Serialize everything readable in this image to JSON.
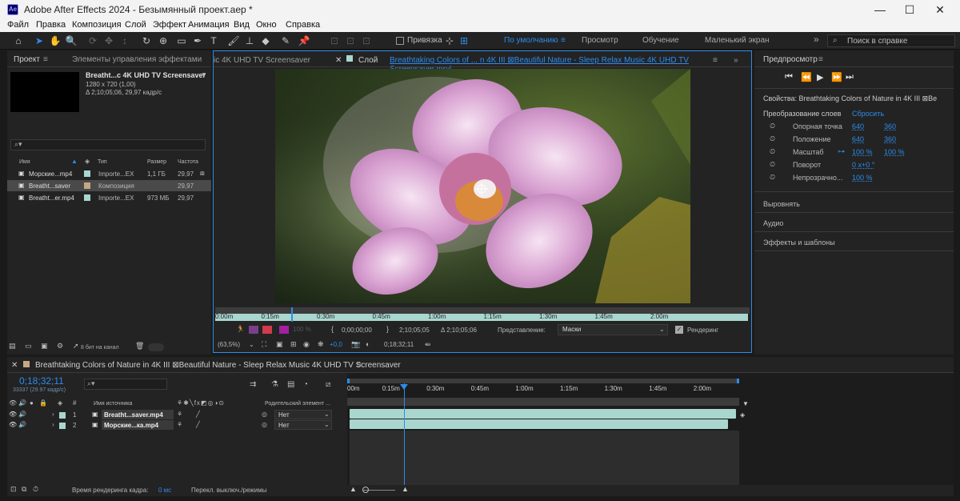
{
  "window": {
    "title": "Adobe After Effects 2024 - Безымянный проект.aep *",
    "app_badge": "Ae"
  },
  "menu": [
    "Файл",
    "Правка",
    "Композиция",
    "Слой",
    "Эффект",
    "Анимация",
    "Вид",
    "Окно",
    "Справка"
  ],
  "toolbar": {
    "snap_label": "Привязка",
    "workspaces": [
      "По умолчанию",
      "Просмотр",
      "Обучение",
      "Маленький экран"
    ],
    "active_workspace": "По умолчанию",
    "help_placeholder": "Поиск в справке"
  },
  "project": {
    "tab_label": "Проект",
    "effects_tab_label": "Элементы управления эффектами",
    "item_name": "Breatht...c 4K UHD TV Screensaver",
    "item_res": "1280 x 720 (1,00)",
    "item_info": "Δ 2;10;05;06, 29,97 кадр/с",
    "columns": [
      "Имя",
      "Тип",
      "Размер",
      "Частота"
    ],
    "items": [
      {
        "name": "Морские...mp4",
        "type": "Importe...EX",
        "size": "1,1 ГБ",
        "fps": "29,97",
        "color": "#a9d6cf",
        "selected": false
      },
      {
        "name": "Breatht...saver",
        "type": "Композиция",
        "size": "",
        "fps": "29,97",
        "color": "#c4a883",
        "selected": true
      },
      {
        "name": "Breatht...er.mp4",
        "type": "Importe...EX",
        "size": "973 МБ",
        "fps": "29,97",
        "color": "#a9d6cf",
        "selected": false
      }
    ],
    "bit_depth": "8 бит на канал"
  },
  "viewer": {
    "comp_tab": "ic 4K UHD TV Screensaver",
    "layer_tab_prefix": "Слой",
    "layer_tab_name": "Breathtaking Colors of ... n 4K III ⊠Beautiful Nature - Sleep Relax Music 4K UHD TV Screensaver.mp4",
    "ruler_labels": [
      "0:00m",
      "0:15m",
      "0:30m",
      "0:45m",
      "1:00m",
      "1:15m",
      "1:30m",
      "1:45m",
      "2:00m"
    ],
    "opacity_label": "100 %",
    "in_time": "0;00;00;00",
    "out_time": "2;10;05;05",
    "duration": "Δ 2;10;05;06",
    "view_label": "Представление:",
    "view_value": "Маски",
    "render_label": "Рендеринг",
    "zoom": "(63,5%)",
    "exposure": "+0,0",
    "current_time": "0;18;32;11"
  },
  "preview": {
    "tab_label": "Предпросмотр",
    "props_title": "Свойства: Breathtaking Colors of Nature in 4K III ⊠Be",
    "transform_label": "Преобразование слоев",
    "reset_label": "Сбросить",
    "props": [
      {
        "name": "Опорная точка",
        "v1": "640",
        "v2": "360"
      },
      {
        "name": "Положение",
        "v1": "640",
        "v2": "360"
      },
      {
        "name": "Масштаб",
        "v1": "100 %",
        "v2": "100 %"
      },
      {
        "name": "Поворот",
        "v1": "0 x+0 °",
        "v2": ""
      },
      {
        "name": "Непрозрачно...",
        "v1": "100 %",
        "v2": ""
      }
    ],
    "sections": [
      "Выровнять",
      "Аудио",
      "Эффекты и шаблоны"
    ]
  },
  "timeline": {
    "comp_name": "Breathtaking Colors of Nature in 4K III ⊠Beautiful Nature - Sleep Relax Music 4K UHD TV Screensaver",
    "timecode": "0;18;32;11",
    "frame_info": "33337 (29.97 кадр/с)",
    "col_source": "Имя источника",
    "col_parent": "Родительский элемент ...",
    "ruler_labels": [
      "00m",
      "0:15m",
      "0:30m",
      "0:45m",
      "1:00m",
      "1:15m",
      "1:30m",
      "1:45m",
      "2:00m"
    ],
    "layers": [
      {
        "num": "1",
        "name": "Breatht...saver.mp4",
        "parent": "Нет",
        "color": "#a9d6cf"
      },
      {
        "num": "2",
        "name": "Морские...ка.mp4",
        "parent": "Нет",
        "color": "#a9d6cf"
      }
    ],
    "render_time_label": "Время рендеринга кадра:",
    "render_time_value": "0 мс",
    "toggle_label": "Перекл. выключ./режимы"
  },
  "colors": {
    "accent": "#2d8ceb",
    "layer_bar": "#a9d6cf",
    "panel_bg": "#232323"
  }
}
